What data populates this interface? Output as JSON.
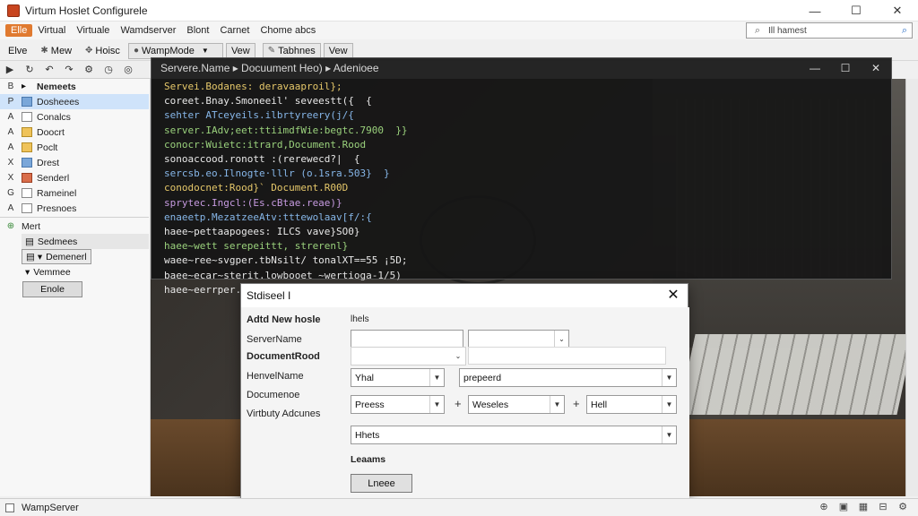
{
  "window": {
    "title": "Virtum Hoslet Configurele",
    "minimize_glyph": "—",
    "maximize_glyph": "☐",
    "close_glyph": "✕"
  },
  "menu": {
    "file_label": "Elle",
    "items": [
      "Virtual",
      "Virtuale",
      "Wamdserver",
      "Blont",
      "Carnet",
      "Chome"
    ],
    "chome_suffix": "abcs"
  },
  "search": {
    "value": "Ill hamest",
    "icon": "search-icon",
    "icon_glyph": "⌕"
  },
  "toolbar": {
    "elve_label": "Elve",
    "new_label": "Mew",
    "hosts_label": "Hoisc",
    "mode_label": "WampMode",
    "view_label": "Vew",
    "tabs_label": "Tabhnes",
    "view2_label": "Vew"
  },
  "sidebar": {
    "header": "Nemeets",
    "items": [
      {
        "gutter": "P",
        "label": "Dosheees",
        "icon": "blue"
      },
      {
        "gutter": "A",
        "label": "Conalcs",
        "icon": "plain"
      },
      {
        "gutter": "A",
        "label": "Doocrt",
        "icon": "folder"
      },
      {
        "gutter": "A",
        "label": "Poclt",
        "icon": "folder"
      },
      {
        "gutter": "X",
        "label": "Drest",
        "icon": "blue"
      },
      {
        "gutter": "X",
        "label": "Senderl",
        "icon": "red"
      },
      {
        "gutter": "G",
        "label": "Rameinel",
        "icon": "plain"
      },
      {
        "gutter": "A",
        "label": "Presnoes",
        "icon": "plain"
      }
    ],
    "section_header": "Mert",
    "sub_items": [
      "Sedmees",
      "Demenerl",
      "Vemmee"
    ],
    "enable_button": "Enole"
  },
  "code_window": {
    "title": "Servere.Name ▸ Docuument Heo) ▸ Adenioee",
    "lines": [
      {
        "gutter": "",
        "text": "Servei.Bodanes: deravaaproil};",
        "color": "c2"
      },
      {
        "gutter": "",
        "text": "coreet.Bnay.Smoneeil' seveestt({  {",
        "color": "c4"
      },
      {
        "gutter": "",
        "text": "sehter ATceyeils.ilbrtyreery(j/{",
        "color": "c1"
      },
      {
        "gutter": "",
        "text": "server.IAdv;eet:ttiimdfWie:begtc.7900  }}",
        "color": "c3"
      },
      {
        "gutter": "",
        "text": "conocr:Wuietc:itrard,Document.Rood",
        "color": "c3"
      },
      {
        "gutter": "",
        "text": "sonoaccood.ronott :(rerewecd?|  {",
        "color": "c4"
      },
      {
        "gutter": "",
        "text": "sercsb.eo.Ilnogte·lllr (o.1sra.503}  }",
        "color": "c1"
      },
      {
        "gutter": "",
        "text": "conodocnet:Rood}` Document.R00D",
        "color": "c2"
      },
      {
        "gutter": "",
        "text": "sprytec.Ingcl:(Es.cBtae.reae)}",
        "color": "c5"
      },
      {
        "gutter": "",
        "text": "enaeetp.MezatzeeAtv:tttewolaav[f/:{",
        "color": "c1"
      },
      {
        "gutter": "",
        "text": "haee~pettaapogees: ILCS vave}SO0}",
        "color": "c4"
      },
      {
        "gutter": "",
        "text": "haee~wett serepeittt, strerenl}",
        "color": "c3"
      },
      {
        "gutter": "",
        "text": "waee~ree~svgper.tbNsilt/ tonalXT==55 ¡5D;",
        "color": "c4"
      },
      {
        "gutter": "",
        "text": "baee~ecar~sterit.lowbooet ~wertioga-1/5)",
        "color": "c4"
      },
      {
        "gutter": "",
        "text": "haee~eerrper.stert(,strerent)}",
        "color": "c4"
      }
    ]
  },
  "dialog": {
    "title": "Stdiseel I",
    "close_glyph": "✕",
    "heading": "Adtd New hosle",
    "heading_note": "lhels",
    "server_name_label": "ServerName",
    "document_root_label": "DocumentRood",
    "hervername_label": "HenvelName",
    "documentoe_label": "Documenoe",
    "vhost_label": "Virtbuty Adcunes",
    "field_yhal": "Yhal",
    "field_prepeerd": "prepeerd",
    "field_preess": "Preess",
    "field_weseles": "Weseles",
    "field_hell": "Hell",
    "field_hhets": "Hhets",
    "leaves_label": "Leaams",
    "button_label": "Lneee"
  },
  "status": {
    "text": "WampServer"
  }
}
